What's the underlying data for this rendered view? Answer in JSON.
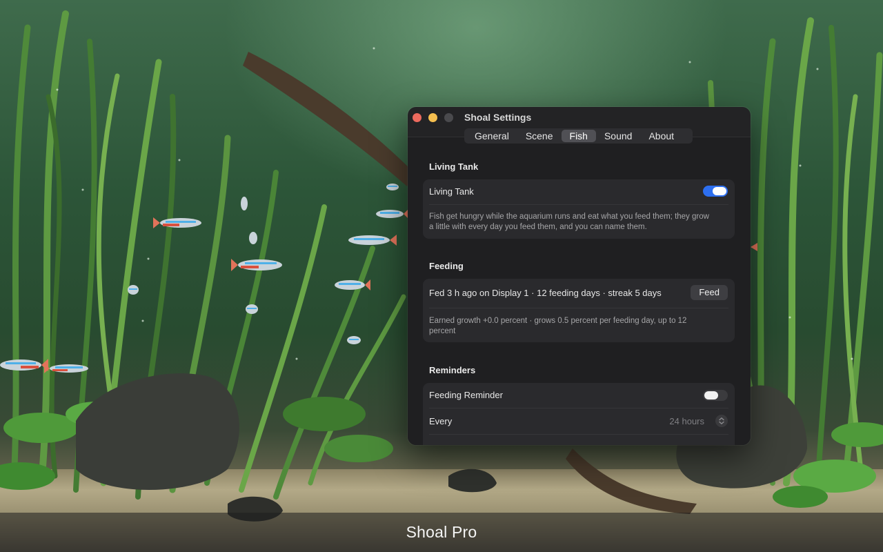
{
  "app": {
    "caption": "Shoal Pro"
  },
  "window": {
    "title": "Shoal Settings",
    "tabs": [
      {
        "label": "General"
      },
      {
        "label": "Scene"
      },
      {
        "label": "Fish",
        "active": true
      },
      {
        "label": "Sound"
      },
      {
        "label": "About"
      }
    ]
  },
  "living_tank": {
    "section_title": "Living Tank",
    "toggle_label": "Living Tank",
    "toggle_on": true,
    "description": "Fish get hungry while the aquarium runs and eat what you feed them; they grow a little with every day you feed them, and you can name them."
  },
  "feeding": {
    "section_title": "Feeding",
    "status": "Fed 3 h ago on Display 1 · 12 feeding days · streak 5 days",
    "feed_button": "Feed",
    "growth_note": "Earned growth +0.0 percent · grows 0.5 percent per feeding day, up to 12 percent"
  },
  "reminders": {
    "section_title": "Reminders",
    "toggle_label": "Feeding Reminder",
    "toggle_on": false,
    "interval_label": "Every",
    "interval_value": "24 hours"
  },
  "colors": {
    "accent": "#2d6ff0",
    "window_bg": "#232325",
    "card_bg": "#2a2a2d",
    "traffic_close": "#ed6a5e",
    "traffic_minimize": "#f5bf4f"
  }
}
